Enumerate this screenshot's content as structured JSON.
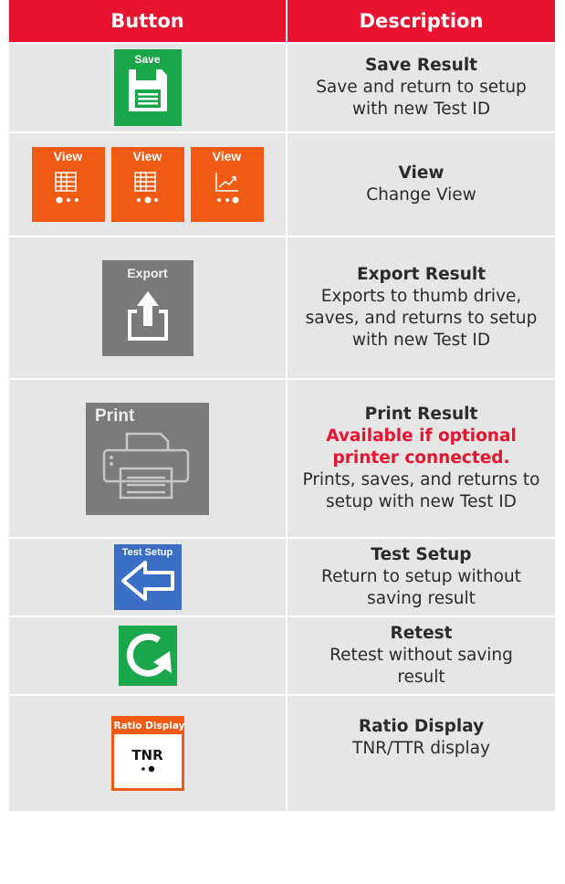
{
  "header": {
    "col_button": "Button",
    "col_description": "Description"
  },
  "rows": {
    "save": {
      "button_label": "Save",
      "title": "Save Result",
      "text": "Save and return to setup with new Test ID"
    },
    "view": {
      "button_labels": [
        "View",
        "View",
        "View"
      ],
      "title": "View",
      "text": "Change View"
    },
    "export": {
      "button_label": "Export",
      "title": "Export Result",
      "text": "Exports to thumb drive, saves, and returns to setup with new Test ID"
    },
    "print": {
      "button_label": "Print",
      "title": "Print Result",
      "warning": "Available if optional printer connected.",
      "text": "Prints, saves, and returns to setup with new Test ID"
    },
    "test_setup": {
      "button_label": "Test Setup",
      "title": "Test Setup",
      "text": "Return to setup without saving result"
    },
    "retest": {
      "title": "Retest",
      "text": "Retest without saving result"
    },
    "ratio": {
      "button_label": "Ratio Display",
      "button_value": "TNR",
      "title": "Ratio Display",
      "text": "TNR/TTR display"
    }
  },
  "colors": {
    "header_red": "#e8132f",
    "row_gray": "#e6e6e6",
    "green": "#1aa64a",
    "orange": "#f05a12",
    "gray_button": "#7a7a7a",
    "blue": "#3a6fc4"
  },
  "icons": {
    "save": "floppy-disk-icon",
    "view": [
      "table-grid-icon",
      "table-grid-icon",
      "line-chart-icon"
    ],
    "export": "upload-tray-icon",
    "print": "printer-icon",
    "test_setup": "arrow-left-icon",
    "retest": "refresh-icon"
  }
}
